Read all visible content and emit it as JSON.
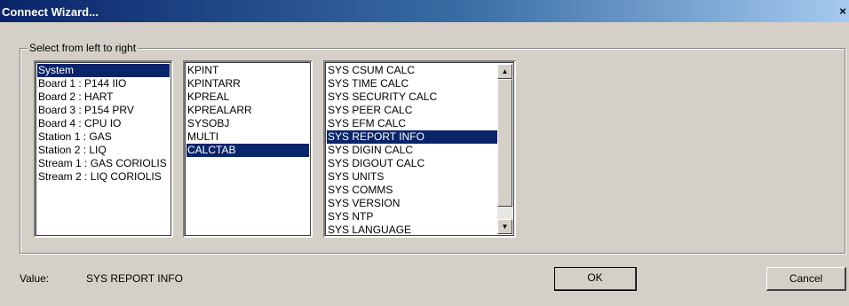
{
  "window": {
    "title": "Connect Wizard...",
    "close_label": "×"
  },
  "group": {
    "legend": "Select from left to right"
  },
  "list_sources": {
    "items": [
      {
        "label": "System",
        "selected": true
      },
      {
        "label": "Board 1 : P144 IIO",
        "selected": false
      },
      {
        "label": "Board 2 : HART",
        "selected": false
      },
      {
        "label": "Board 3 : P154 PRV",
        "selected": false
      },
      {
        "label": "Board 4 : CPU IO",
        "selected": false
      },
      {
        "label": "Station 1 : GAS",
        "selected": false
      },
      {
        "label": "Station 2 : LIQ",
        "selected": false
      },
      {
        "label": "Stream 1 : GAS CORIOLIS",
        "selected": false
      },
      {
        "label": "Stream 2 : LIQ CORIOLIS",
        "selected": false
      }
    ]
  },
  "list_types": {
    "items": [
      {
        "label": "KPINT",
        "selected": false
      },
      {
        "label": "KPINTARR",
        "selected": false
      },
      {
        "label": "KPREAL",
        "selected": false
      },
      {
        "label": "KPREALARR",
        "selected": false
      },
      {
        "label": "SYSOBJ",
        "selected": false
      },
      {
        "label": "MULTI",
        "selected": false
      },
      {
        "label": "CALCTAB",
        "selected": true
      }
    ]
  },
  "list_objects": {
    "items": [
      {
        "label": "SYS CSUM CALC",
        "selected": false
      },
      {
        "label": "SYS TIME CALC",
        "selected": false
      },
      {
        "label": "SYS SECURITY CALC",
        "selected": false
      },
      {
        "label": "SYS PEER CALC",
        "selected": false
      },
      {
        "label": "SYS EFM CALC",
        "selected": false
      },
      {
        "label": "SYS REPORT INFO",
        "selected": true
      },
      {
        "label": "SYS DIGIN CALC",
        "selected": false
      },
      {
        "label": "SYS DIGOUT CALC",
        "selected": false
      },
      {
        "label": "SYS UNITS",
        "selected": false
      },
      {
        "label": "SYS COMMS",
        "selected": false
      },
      {
        "label": "SYS VERSION",
        "selected": false
      },
      {
        "label": "SYS NTP",
        "selected": false
      },
      {
        "label": "SYS LANGUAGE",
        "selected": false
      }
    ],
    "scroll_up_icon": "▲",
    "scroll_down_icon": "▼"
  },
  "footer": {
    "value_label": "Value:",
    "value_text": "SYS REPORT INFO",
    "ok_label": "OK",
    "cancel_label": "Cancel"
  },
  "colors": {
    "selection": "#0a246a",
    "title_start": "#0a246a",
    "title_end": "#a6caf0",
    "dialog_bg": "#d4d0c8"
  }
}
